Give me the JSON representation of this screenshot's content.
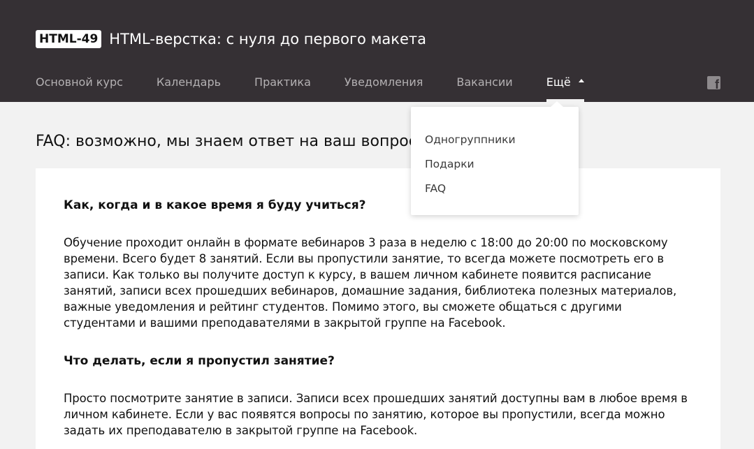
{
  "header": {
    "badge": "HTML-49",
    "title": "HTML-верстка: с нуля до первого макета"
  },
  "nav": {
    "items": [
      {
        "label": "Основной курс"
      },
      {
        "label": "Календарь"
      },
      {
        "label": "Практика"
      },
      {
        "label": "Уведомления"
      },
      {
        "label": "Вакансии"
      },
      {
        "label": "Ещё"
      }
    ],
    "social_icon": "facebook-icon"
  },
  "dropdown": {
    "items": [
      {
        "label": "Одногруппники"
      },
      {
        "label": "Подарки"
      },
      {
        "label": "FAQ"
      }
    ]
  },
  "page": {
    "heading": "FAQ: возможно, мы знаем ответ на ваш вопрос"
  },
  "faq": [
    {
      "question": "Как, когда и в какое время я буду учиться?",
      "answer": "Обучение проходит онлайн в формате вебинаров 3 раза в неделю с 18:00 до 20:00 по московскому времени. Всего будет 8 занятий. Если вы пропустили занятие, то всегда можете посмотреть его в записи. Как только вы получите доступ к курсу, в вашем личном кабинете появится расписание занятий, записи всех прошедших вебинаров, домашние задания, библиотека полезных материалов, важные уведомления и рейтинг студентов. Помимо этого, вы сможете общаться с другими студентами и вашими преподавателями в закрытой группе на Facebook."
    },
    {
      "question": "Что делать, если я пропустил занятие?",
      "answer": "Просто посмотрите занятие в записи. Записи всех прошедших занятий доступны вам в любое время в личном кабинете. Если у вас появятся вопросы по занятию, которое вы пропустили, всегда можно задать их преподавателю в закрытой группе на Facebook."
    }
  ],
  "colors": {
    "header_bg": "#353034",
    "page_bg": "#f2f2f2",
    "nav_inactive": "#b4b1b3",
    "nav_active": "#ffffff"
  }
}
